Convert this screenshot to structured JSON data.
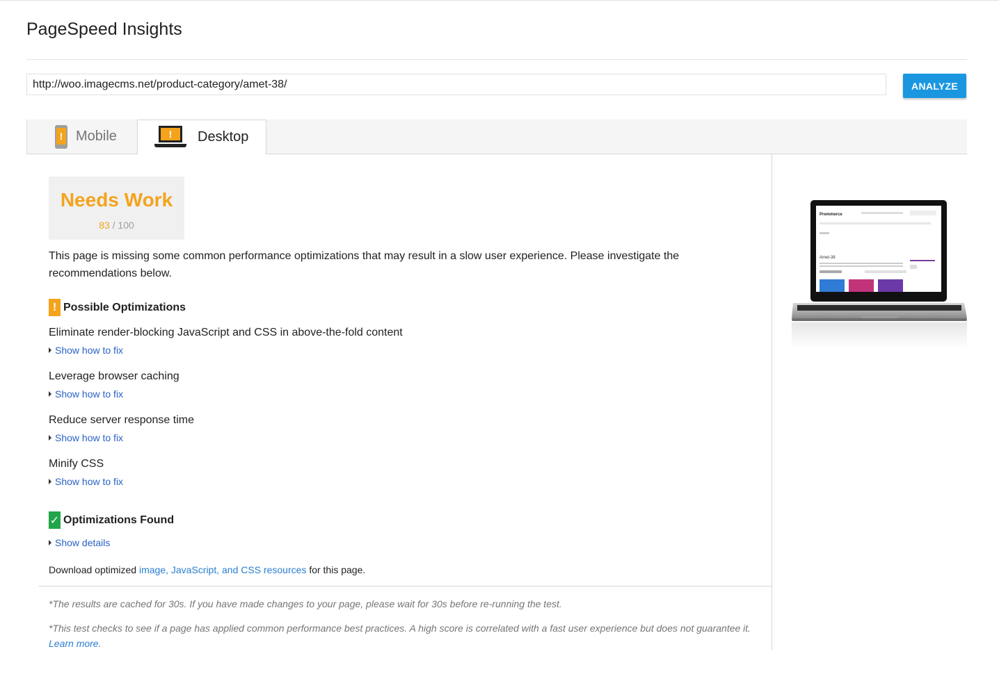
{
  "app": {
    "title": "PageSpeed Insights"
  },
  "search": {
    "url": "http://woo.imagecms.net/product-category/amet-38/",
    "analyze_label": "ANALYZE"
  },
  "tabs": [
    {
      "label": "Mobile",
      "active": false
    },
    {
      "label": "Desktop",
      "active": true
    }
  ],
  "score": {
    "label": "Needs Work",
    "value": "83",
    "max": "/ 100",
    "color": "#f4a31d"
  },
  "summary": "This page is missing some common performance optimizations that may result in a slow user experience. Please investigate the recommendations below.",
  "possible": {
    "title": "Possible Optimizations",
    "badge": "!",
    "items": [
      {
        "title": "Eliminate render-blocking JavaScript and CSS in above-the-fold content",
        "link": "Show how to fix"
      },
      {
        "title": "Leverage browser caching",
        "link": "Show how to fix"
      },
      {
        "title": "Reduce server response time",
        "link": "Show how to fix"
      },
      {
        "title": "Minify CSS",
        "link": "Show how to fix"
      }
    ]
  },
  "found": {
    "title": "Optimizations Found",
    "badge": "✓",
    "link": "Show details"
  },
  "download": {
    "prefix": "Download optimized",
    "link": "image, JavaScript, and CSS resources",
    "suffix": "for this page."
  },
  "notes": {
    "cache": "*The results are cached for 30s. If you have made changes to your page, please wait for 30s before re-running the test.",
    "test": "*This test checks to see if a page has applied common performance best practices. A high score is correlated with a fast user experience but does not guarantee it.",
    "learn_more": "Learn more."
  },
  "preview": {
    "site_logo": "Premmerce",
    "page_heading": "Amet-38"
  },
  "colors": {
    "accent": "#1a97e0",
    "warning": "#f4a31d",
    "success": "#21a54a",
    "link": "#2a62c5"
  }
}
